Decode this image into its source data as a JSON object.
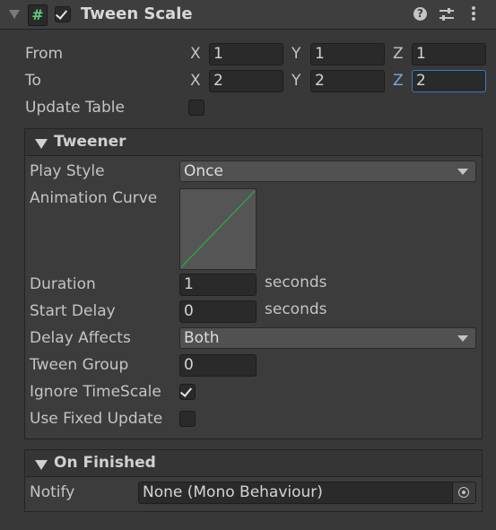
{
  "header": {
    "title": "Tween Scale",
    "enabled": true,
    "icons": [
      "foldout-icon",
      "script-icon",
      "help-icon",
      "presets-icon",
      "menu-icon"
    ]
  },
  "from": {
    "label": "From",
    "x_label": "X",
    "x": "1",
    "y_label": "Y",
    "y": "1",
    "z_label": "Z",
    "z": "1"
  },
  "to": {
    "label": "To",
    "x_label": "X",
    "x": "2",
    "y_label": "Y",
    "y": "2",
    "z_label": "Z",
    "z": "2"
  },
  "update_table": {
    "label": "Update Table",
    "checked": false
  },
  "tweener": {
    "title": "Tweener",
    "play_style": {
      "label": "Play Style",
      "value": "Once"
    },
    "animation_curve": {
      "label": "Animation Curve",
      "curve_color": "#2ea043"
    },
    "duration": {
      "label": "Duration",
      "value": "1",
      "unit": "seconds"
    },
    "start_delay": {
      "label": "Start Delay",
      "value": "0",
      "unit": "seconds"
    },
    "delay_affects": {
      "label": "Delay Affects",
      "value": "Both"
    },
    "tween_group": {
      "label": "Tween Group",
      "value": "0"
    },
    "ignore_timescale": {
      "label": "Ignore TimeScale",
      "checked": true
    },
    "use_fixed_update": {
      "label": "Use Fixed Update",
      "checked": false
    }
  },
  "on_finished": {
    "title": "On Finished",
    "notify": {
      "label": "Notify",
      "value": "None (Mono Behaviour)"
    }
  },
  "colors": {
    "focus": "#3a79c4",
    "axis_active": "#7aa7e0"
  }
}
